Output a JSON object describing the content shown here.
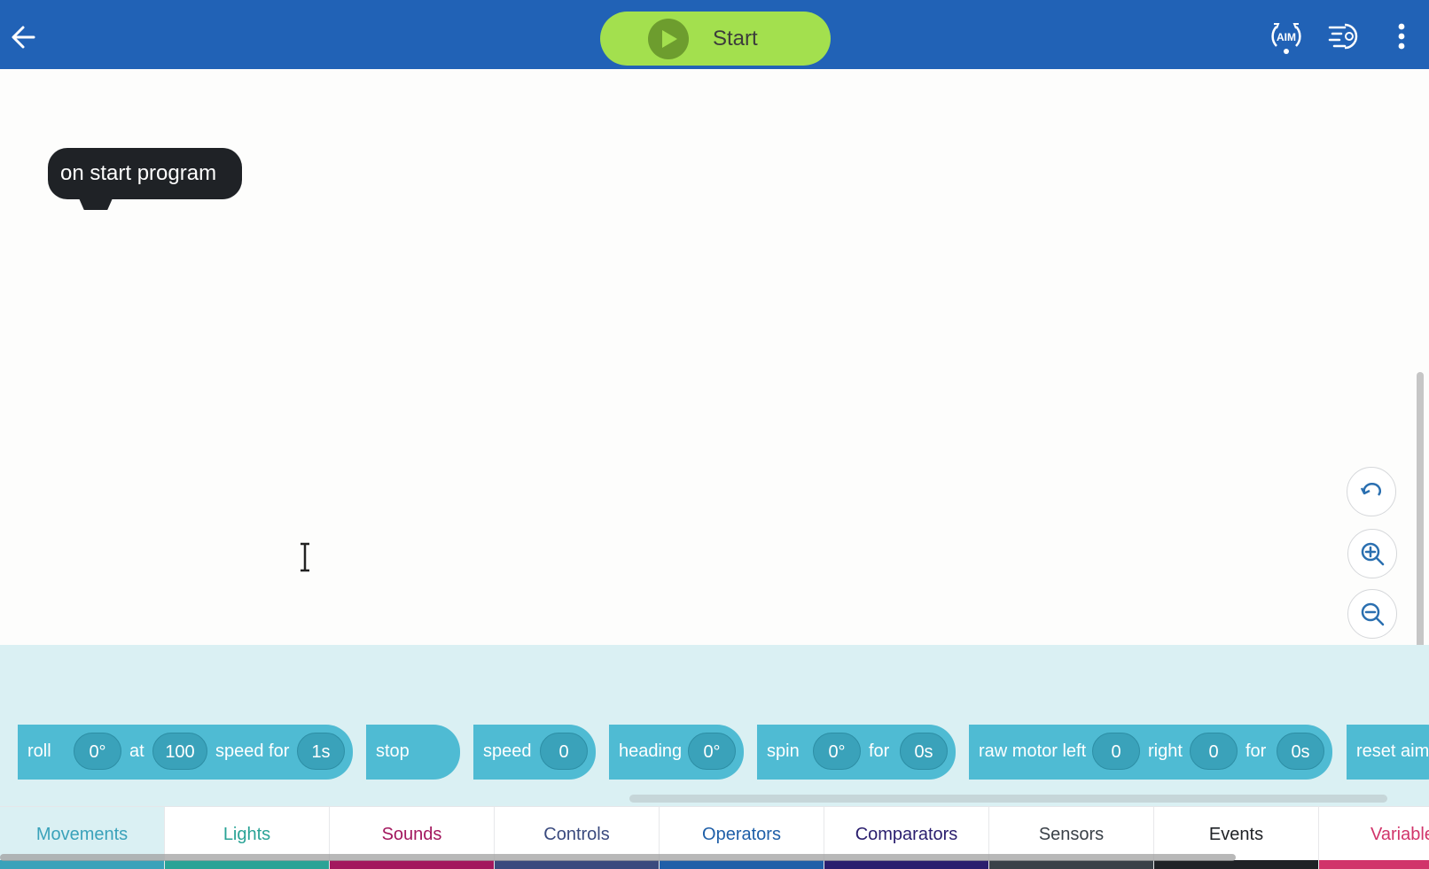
{
  "header": {
    "back_icon": "arrow-left-icon",
    "start_label": "Start",
    "aim_icon_label": "AIM",
    "icons": [
      "aim-icon",
      "program-settings-icon",
      "more-vertical-icon"
    ],
    "color": "#2162b6"
  },
  "canvas": {
    "start_block_label": "on start program",
    "tools": [
      "undo-icon",
      "zoom-in-icon",
      "zoom-out-icon"
    ]
  },
  "palette": {
    "blocks": [
      {
        "parts": [
          "roll",
          "0°",
          "at",
          "100",
          "speed for",
          "1s"
        ]
      },
      {
        "parts": [
          "stop"
        ]
      },
      {
        "parts": [
          "speed",
          "0"
        ]
      },
      {
        "parts": [
          "heading",
          "0°"
        ]
      },
      {
        "parts": [
          "spin",
          "0°",
          "for",
          "0s"
        ]
      },
      {
        "parts": [
          "raw motor left",
          "0",
          "right",
          "0",
          "for",
          "0s"
        ]
      },
      {
        "parts": [
          "reset aim"
        ]
      }
    ]
  },
  "tabs": [
    {
      "label": "Movements",
      "color": "#3aa2ba",
      "active": true
    },
    {
      "label": "Lights",
      "color": "#2aa396"
    },
    {
      "label": "Sounds",
      "color": "#a3185e"
    },
    {
      "label": "Controls",
      "color": "#3a4a7e"
    },
    {
      "label": "Operators",
      "color": "#1f5fa8"
    },
    {
      "label": "Comparators",
      "color": "#2a1e6e"
    },
    {
      "label": "Sensors",
      "color": "#3a4148"
    },
    {
      "label": "Events",
      "color": "#1f2226"
    },
    {
      "label": "Variable",
      "color": "#d1346a"
    }
  ]
}
